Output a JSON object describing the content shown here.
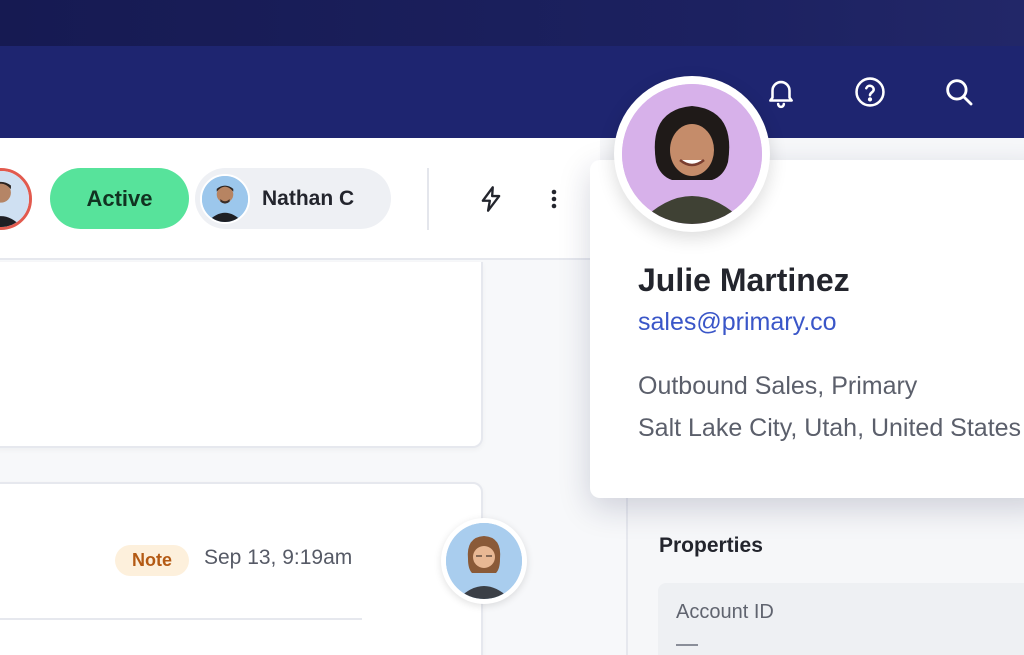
{
  "header": {
    "icons": [
      "bell-icon",
      "help-icon",
      "search-icon"
    ]
  },
  "toolbar": {
    "status_label": "Active",
    "owner_name": "Nathan C",
    "icons": [
      "lightning-icon",
      "more-vertical-icon"
    ]
  },
  "activity": {
    "note_badge": "Note",
    "note_timestamp": "Sep 13, 9:19am"
  },
  "contact_popover": {
    "name": "Julie Martinez",
    "email": "sales@primary.co",
    "title_line": "Outbound Sales, Primary",
    "location": "Salt Lake City, Utah, United States"
  },
  "properties": {
    "title": "Properties",
    "fields": [
      {
        "label": "Account ID",
        "value": "—"
      }
    ]
  },
  "colors": {
    "nav_background": "#1e2570",
    "status_active": "#57e39b",
    "link_blue": "#3a56c8",
    "note_badge_bg": "#fdf0dc",
    "note_badge_text": "#b45a14",
    "avatar_ring_alert": "#e25a4e"
  }
}
